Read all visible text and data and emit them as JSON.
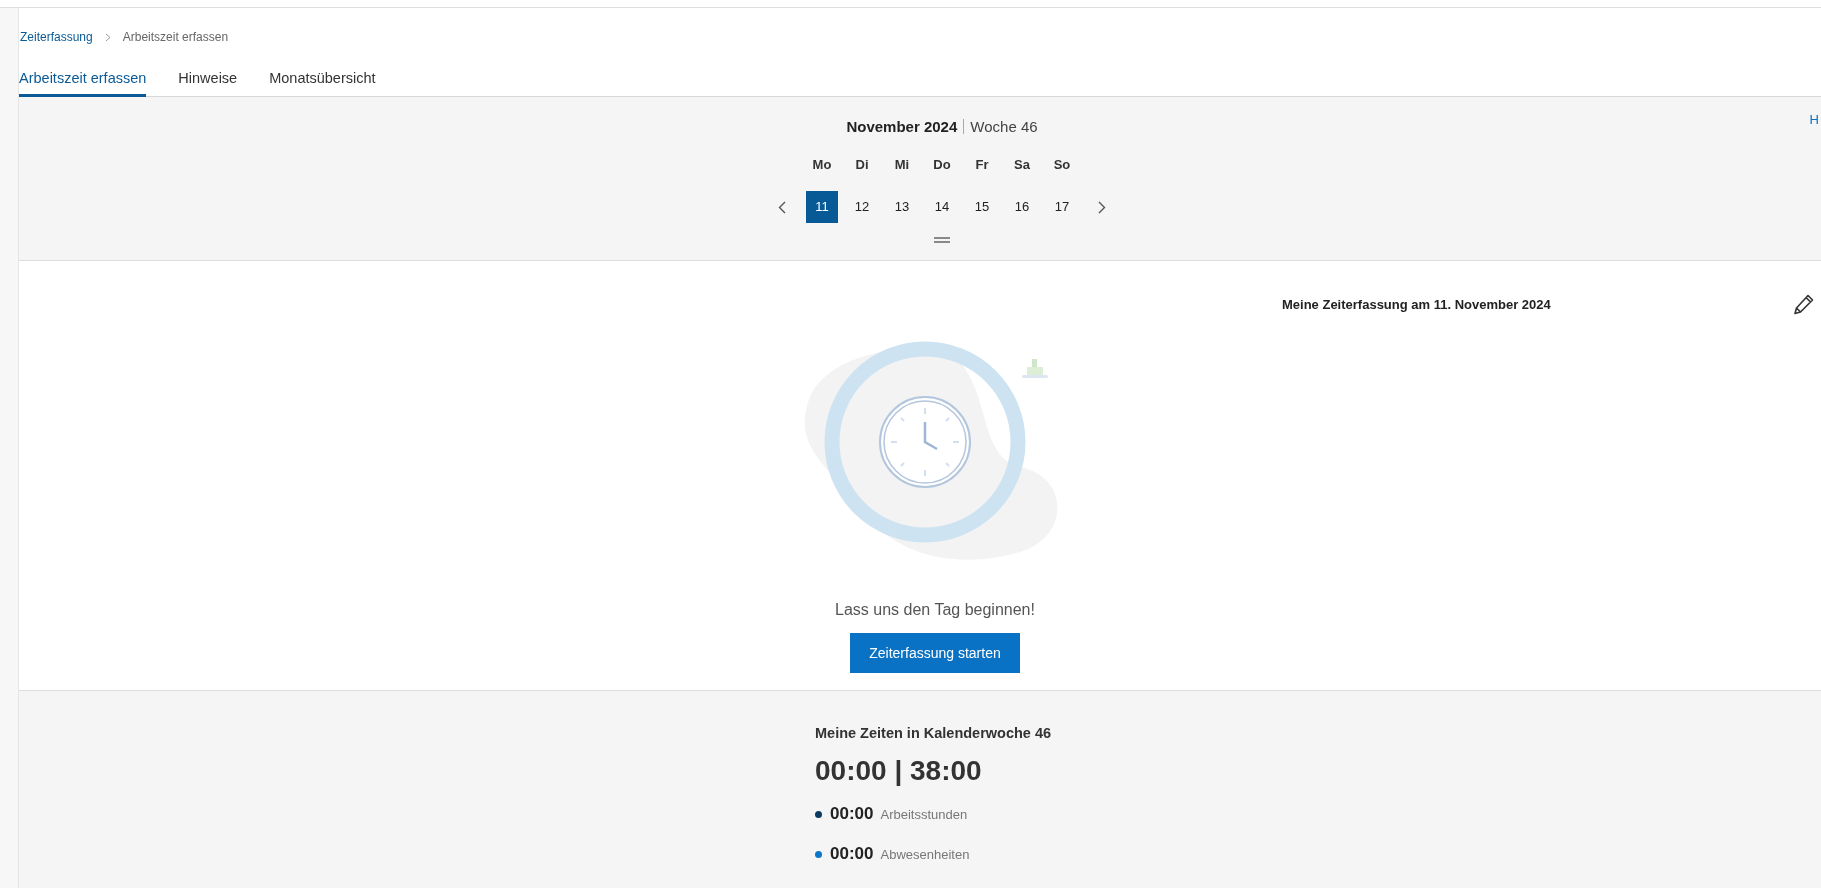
{
  "breadcrumb": [
    {
      "label": "Zeiterfassung",
      "link": true
    },
    {
      "label": "Arbeitszeit erfassen",
      "link": false
    }
  ],
  "tabs": [
    {
      "label": "Arbeitszeit erfassen",
      "selected": true
    },
    {
      "label": "Hinweise",
      "selected": false
    },
    {
      "label": "Monatsübersicht",
      "selected": false
    }
  ],
  "week_picker": {
    "month": "November 2024",
    "week": "Woche 46",
    "weekdays": [
      "Mo",
      "Di",
      "Mi",
      "Do",
      "Fr",
      "Sa",
      "So"
    ],
    "days": [
      {
        "label": "11",
        "selected": true
      },
      {
        "label": "12",
        "selected": false
      },
      {
        "label": "13",
        "selected": false
      },
      {
        "label": "14",
        "selected": false
      },
      {
        "label": "15",
        "selected": false
      },
      {
        "label": "16",
        "selected": false
      },
      {
        "label": "17",
        "selected": false
      }
    ]
  },
  "side_link": "H",
  "day_panel": {
    "title": "Meine Zeiterfassung am 11. November 2024",
    "message": "Lass uns den Tag beginnen!",
    "button": "Zeiterfassung starten"
  },
  "week_summary": {
    "title": "Meine Zeiten in Kalenderwoche 46",
    "total": "00:00 | 38:00",
    "items": [
      {
        "value": "00:00",
        "label": "Arbeitsstunden",
        "color": "#0b3a60"
      },
      {
        "value": "00:00",
        "label": "Abwesenheiten",
        "color": "#0a78c8"
      }
    ]
  }
}
